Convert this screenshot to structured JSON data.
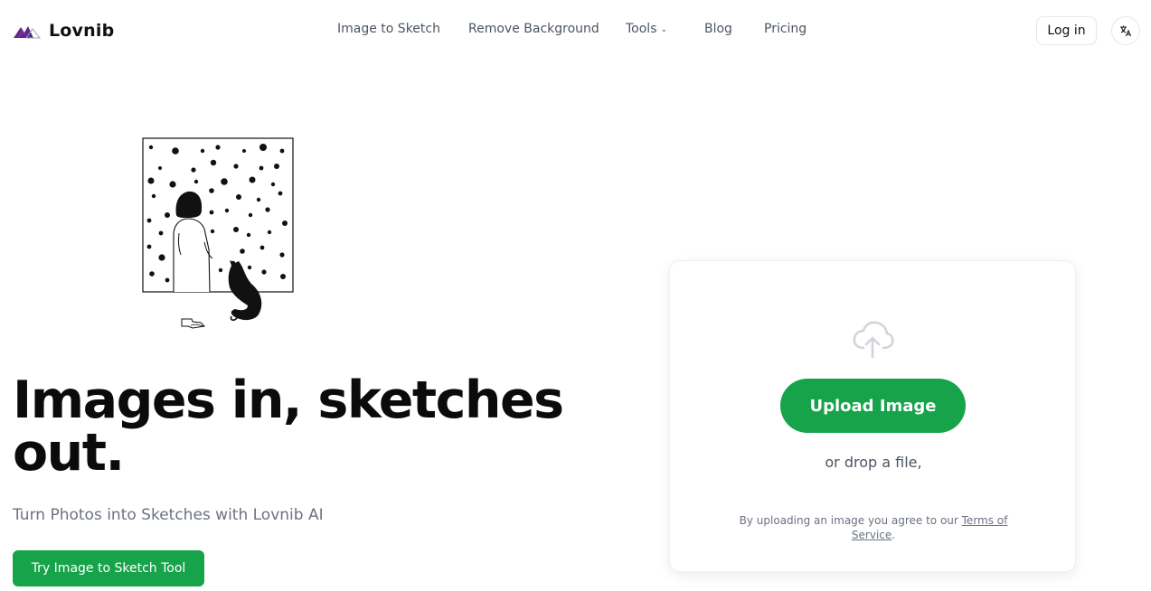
{
  "brand": {
    "name": "Lovnib",
    "colors": {
      "accent": "#16a34a",
      "logo_purple": "#5b2a86",
      "logo_gray": "#9ca3af"
    }
  },
  "nav": {
    "items": [
      {
        "label": "Image to Sketch"
      },
      {
        "label": "Remove Background"
      },
      {
        "label": "Tools",
        "icon": "chevron-down-icon"
      },
      {
        "label": "Blog"
      },
      {
        "label": "Pricing"
      }
    ],
    "login_label": "Log in",
    "language_icon": "translate-icon"
  },
  "hero": {
    "title": "Images in, sketches out.",
    "subtitle": "Turn Photos into Sketches with Lovnib AI",
    "cta_label": "Try Image to Sketch Tool",
    "illustration": "girl-and-cat-at-snowy-window"
  },
  "upload": {
    "icon": "cloud-upload-icon",
    "button_label": "Upload Image",
    "drop_text": "or drop a file,",
    "terms_prefix": "By uploading an image you agree to our ",
    "terms_link": "Terms of Service",
    "terms_suffix": "."
  }
}
